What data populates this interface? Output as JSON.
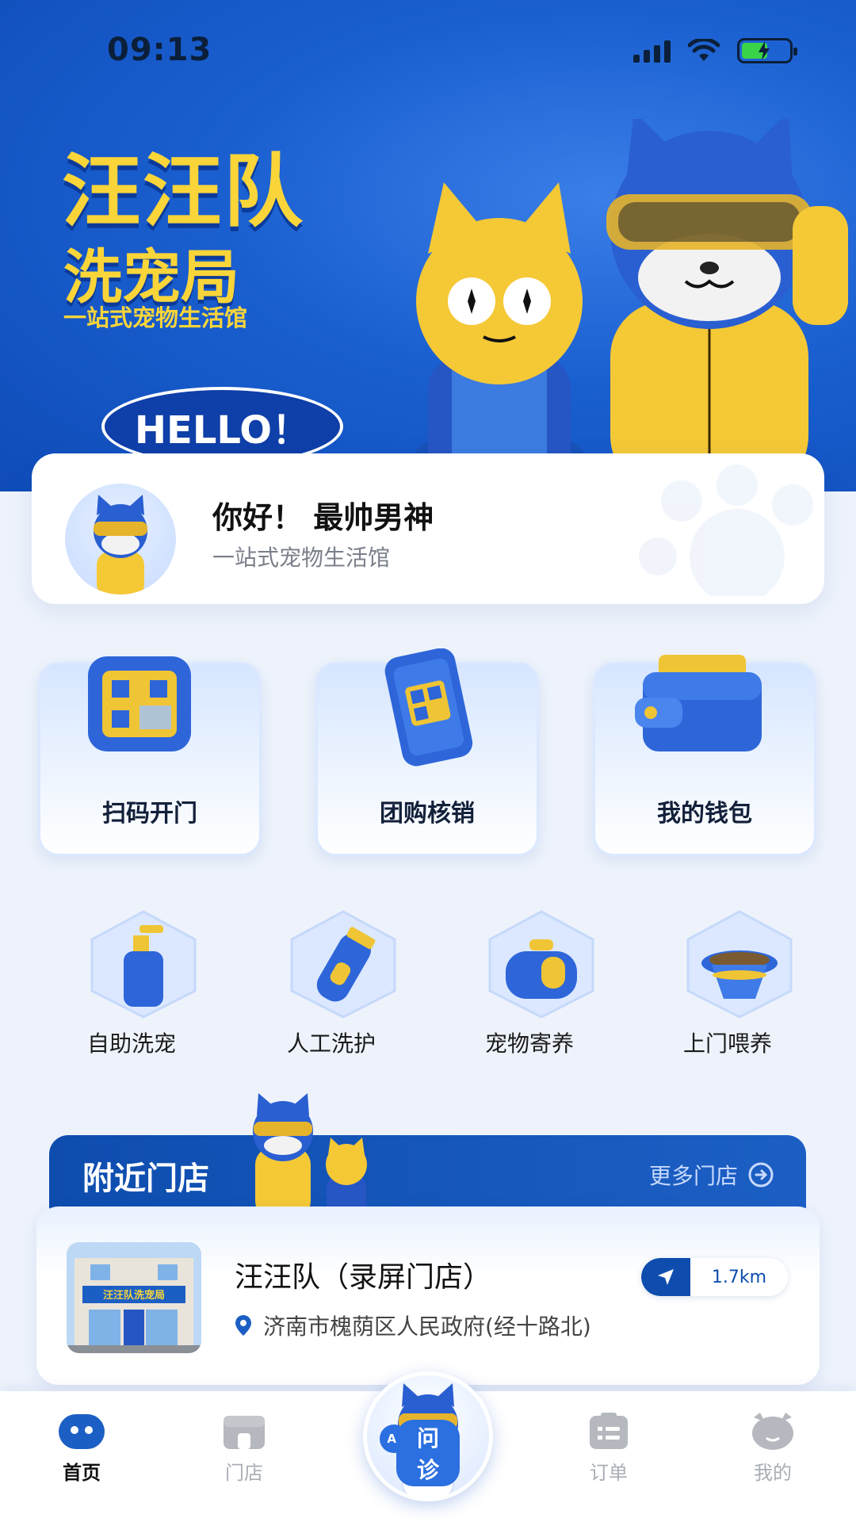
{
  "status_bar": {
    "time": "09:13"
  },
  "hero": {
    "title": "汪汪队",
    "subtitle": "洗宠局",
    "slogan": "一站式宠物生活馆",
    "bubble": "HELLO！"
  },
  "greeting": {
    "title": "你好！ 最帅男神",
    "subtitle": "一站式宠物生活馆"
  },
  "quick_tiles": [
    {
      "label": "扫码开门",
      "icon": "qr-scan-icon"
    },
    {
      "label": "团购核销",
      "icon": "phone-qr-icon"
    },
    {
      "label": "我的钱包",
      "icon": "wallet-icon"
    }
  ],
  "services": [
    {
      "label": "自助洗宠",
      "icon": "shampoo-bottle-icon"
    },
    {
      "label": "人工洗护",
      "icon": "pet-clipper-icon"
    },
    {
      "label": "宠物寄养",
      "icon": "pet-carrier-icon"
    },
    {
      "label": "上门喂养",
      "icon": "food-bowl-icon"
    }
  ],
  "nearby": {
    "title": "附近门店",
    "more_label": "更多门店",
    "store": {
      "name": "汪汪队（录屏门店）",
      "address": "济南市槐荫区人民政府(经十路北)",
      "distance": "1.7km",
      "sign_text": "汪汪队洗宠局"
    }
  },
  "bottom_nav": {
    "items": [
      {
        "label": "首页",
        "active": true
      },
      {
        "label": "门店",
        "active": false
      },
      {
        "label": "问诊",
        "badge": "AI"
      },
      {
        "label": "订单",
        "active": false
      },
      {
        "label": "我的",
        "active": false
      }
    ]
  },
  "colors": {
    "brand_blue": "#0e4dae",
    "brand_yellow": "#f9d53a",
    "accent_blue": "#2b6fe0"
  }
}
